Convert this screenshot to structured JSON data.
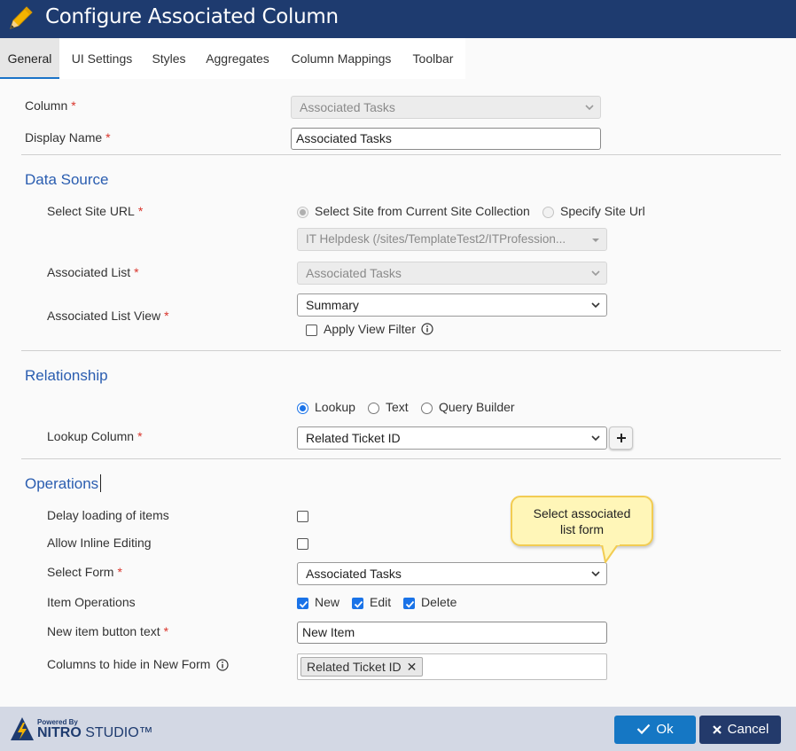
{
  "dialog": {
    "title": "Configure Associated Column"
  },
  "tabs": [
    "General",
    "UI Settings",
    "Styles",
    "Aggregates",
    "Column Mappings",
    "Toolbar"
  ],
  "general": {
    "column_label": "Column",
    "column_value": "Associated Tasks",
    "display_name_label": "Display Name",
    "display_name_value": "Associated Tasks",
    "required_marker": "*"
  },
  "data_source": {
    "heading": "Data Source",
    "site_url_label": "Select Site URL",
    "radio_current": "Select Site from Current Site Collection",
    "radio_specify": "Specify Site Url",
    "site_value": "IT Helpdesk (/sites/TemplateTest2/ITProfession...",
    "associated_list_label": "Associated List",
    "associated_list_value": "Associated Tasks",
    "list_view_label": "Associated List View",
    "list_view_value": "Summary",
    "apply_filter_label": "Apply View Filter"
  },
  "relationship": {
    "heading": "Relationship",
    "radio_lookup": "Lookup",
    "radio_text": "Text",
    "radio_query": "Query Builder",
    "lookup_column_label": "Lookup Column",
    "lookup_column_value": "Related Ticket ID"
  },
  "operations": {
    "heading": "Operations",
    "delay_label": "Delay loading of items",
    "inline_label": "Allow Inline Editing",
    "select_form_label": "Select Form",
    "select_form_value": "Associated Tasks",
    "item_ops_label": "Item Operations",
    "op_new": "New",
    "op_edit": "Edit",
    "op_delete": "Delete",
    "new_btn_text_label": "New item button text",
    "new_btn_text_value": "New Item",
    "hide_cols_label": "Columns to hide in New Form",
    "hidden_tag": "Related Ticket ID"
  },
  "tooltip": {
    "line1": "Select associated",
    "line2": "list form"
  },
  "footer": {
    "powered_by": "Powered By",
    "brand_bold": "NITRO",
    "brand_rest": "STUDIO™",
    "ok_label": "Ok",
    "cancel_label": "Cancel"
  },
  "colors": {
    "title_bar": "#1e3b6f",
    "section_heading": "#2a5db0",
    "required": "#d9342b",
    "ok_button": "#1577c4",
    "cancel_button": "#233a6b",
    "tooltip_bg": "#fff6b8",
    "footer_bg": "#d3d8e4"
  }
}
